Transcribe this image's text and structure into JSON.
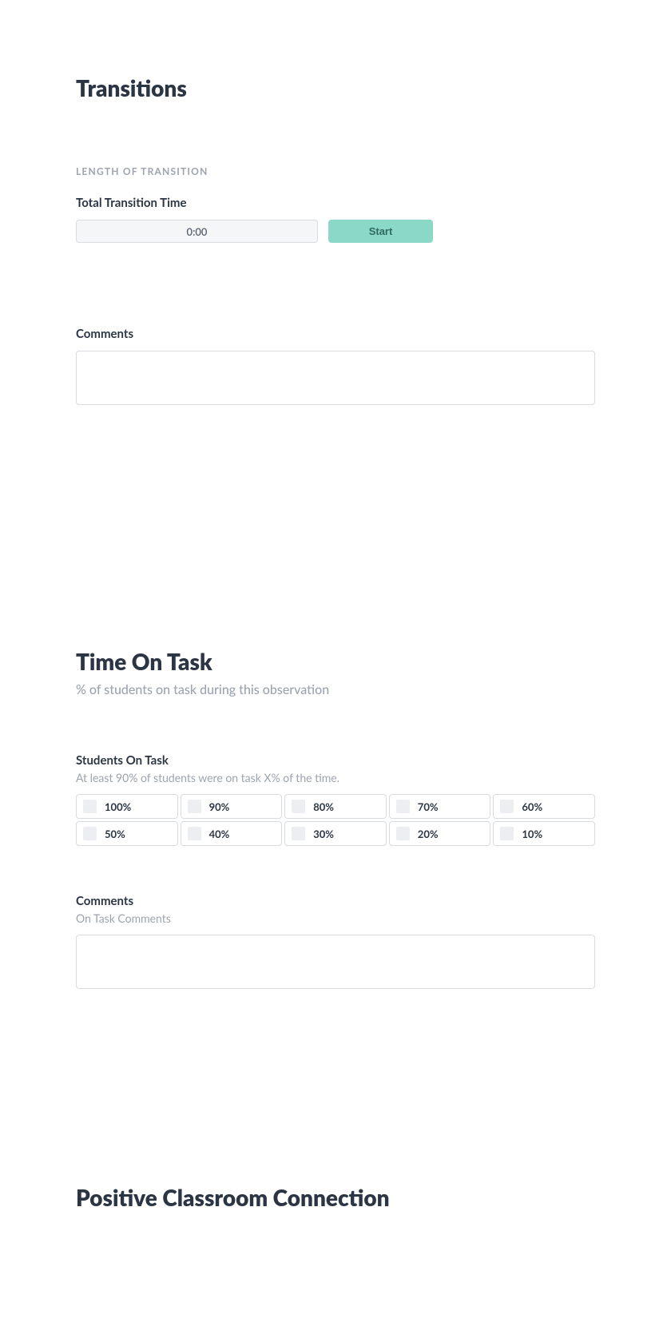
{
  "transitions": {
    "title": "Transitions",
    "lengthOverline": "LENGTH OF TRANSITION",
    "totalLabel": "Total Transition Time",
    "timerValue": "0:00",
    "startLabel": "Start",
    "commentsLabel": "Comments"
  },
  "timeOnTask": {
    "title": "Time On Task",
    "subtitle": "% of students on task during this observation",
    "studentsLabel": "Students On Task",
    "studentsSub": "At least 90% of students were on task X% of the time.",
    "options": [
      "100%",
      "90%",
      "80%",
      "70%",
      "60%",
      "50%",
      "40%",
      "30%",
      "20%",
      "10%"
    ],
    "commentsLabel": "Comments",
    "commentsSub": "On Task Comments"
  },
  "positive": {
    "title": "Positive Classroom Connection"
  }
}
